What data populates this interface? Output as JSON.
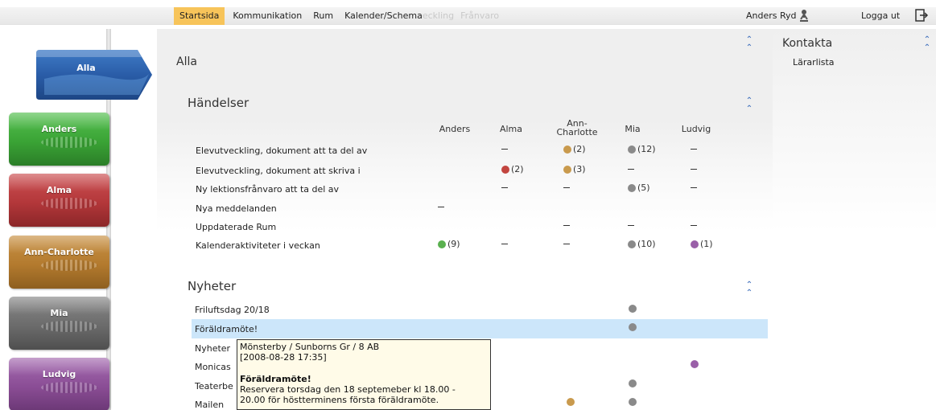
{
  "nav": {
    "items": [
      "Startsida",
      "Kommunikation",
      "Rum",
      "Kalender/Schema"
    ],
    "faded_items": [
      "eckling",
      "Frånvaro"
    ],
    "active": "Startsida"
  },
  "user": {
    "name": "Anders Ryd",
    "logout_label": "Logga ut"
  },
  "sidebar": {
    "children": [
      {
        "name": "Alla",
        "color": "#2a5da8"
      },
      {
        "name": "Anders",
        "color": "#3aa335"
      },
      {
        "name": "Alma",
        "color": "#b3373a"
      },
      {
        "name": "Ann-Charlotte",
        "color": "#b37a2e"
      },
      {
        "name": "Mia",
        "color": "#6b6b6b"
      },
      {
        "name": "Ludvig",
        "color": "#8a4d95"
      }
    ]
  },
  "main": {
    "title": "Alla",
    "events": {
      "title": "Händelser",
      "columns": [
        "Anders",
        "Alma",
        "Ann-Charlotte",
        "Mia",
        "Ludvig"
      ],
      "rows": [
        {
          "label": "Elevutveckling, dokument att ta del av",
          "cells": [
            "",
            "–",
            "(2)",
            "(12)",
            "–"
          ],
          "dots": [
            "",
            "",
            "orange",
            "gray",
            ""
          ]
        },
        {
          "label": "Elevutveckling, dokument att skriva i",
          "cells": [
            "",
            "(2)",
            "(3)",
            "–",
            "–"
          ],
          "dots": [
            "",
            "red",
            "orange",
            "",
            ""
          ]
        },
        {
          "label": "Ny lektionsfrånvaro att ta del av",
          "cells": [
            "",
            "–",
            "–",
            "(5)",
            "–"
          ],
          "dots": [
            "",
            "",
            "",
            "gray",
            ""
          ]
        },
        {
          "label": "Nya meddelanden",
          "cells": [
            "–",
            "",
            "",
            "",
            ""
          ],
          "dots": [
            "",
            "",
            "",
            "",
            ""
          ]
        },
        {
          "label": "Uppdaterade Rum",
          "cells": [
            "",
            "",
            "–",
            "–",
            "–"
          ],
          "dots": [
            "",
            "",
            "",
            "",
            ""
          ]
        },
        {
          "label": "Kalenderaktiviteter i veckan",
          "cells": [
            "(9)",
            "–",
            "–",
            "(10)",
            "(1)"
          ],
          "dots": [
            "green",
            "",
            "",
            "gray",
            "purple"
          ]
        }
      ]
    },
    "news": {
      "title": "Nyheter",
      "rows": [
        {
          "label": "Friluftsdag 20/18"
        },
        {
          "label": "Föräldramöte!"
        },
        {
          "label": "Nyheter"
        },
        {
          "label": "Monicas"
        },
        {
          "label": "Teaterbe"
        },
        {
          "label": "Mailen"
        }
      ]
    },
    "tooltip": {
      "source": "Mönsterby / Sunborns Gr / 8 AB",
      "date": "[2008-08-28 17:35]",
      "title": "Föräldramöte!",
      "body_line1": "Reservera torsdag den 18 septemeber kl 18.00 -",
      "body_line2": "20.00 för höstterminens första föräldramöte."
    }
  },
  "contact": {
    "title": "Kontakta",
    "link": "Lärarlista"
  },
  "colors": {
    "green": "#5ab04f",
    "red": "#c2453f",
    "orange": "#c99a4d",
    "gray": "#8a8a8a",
    "purple": "#9a5fa8",
    "accent": "#f7c45a",
    "highlight": "#cce6fa"
  }
}
